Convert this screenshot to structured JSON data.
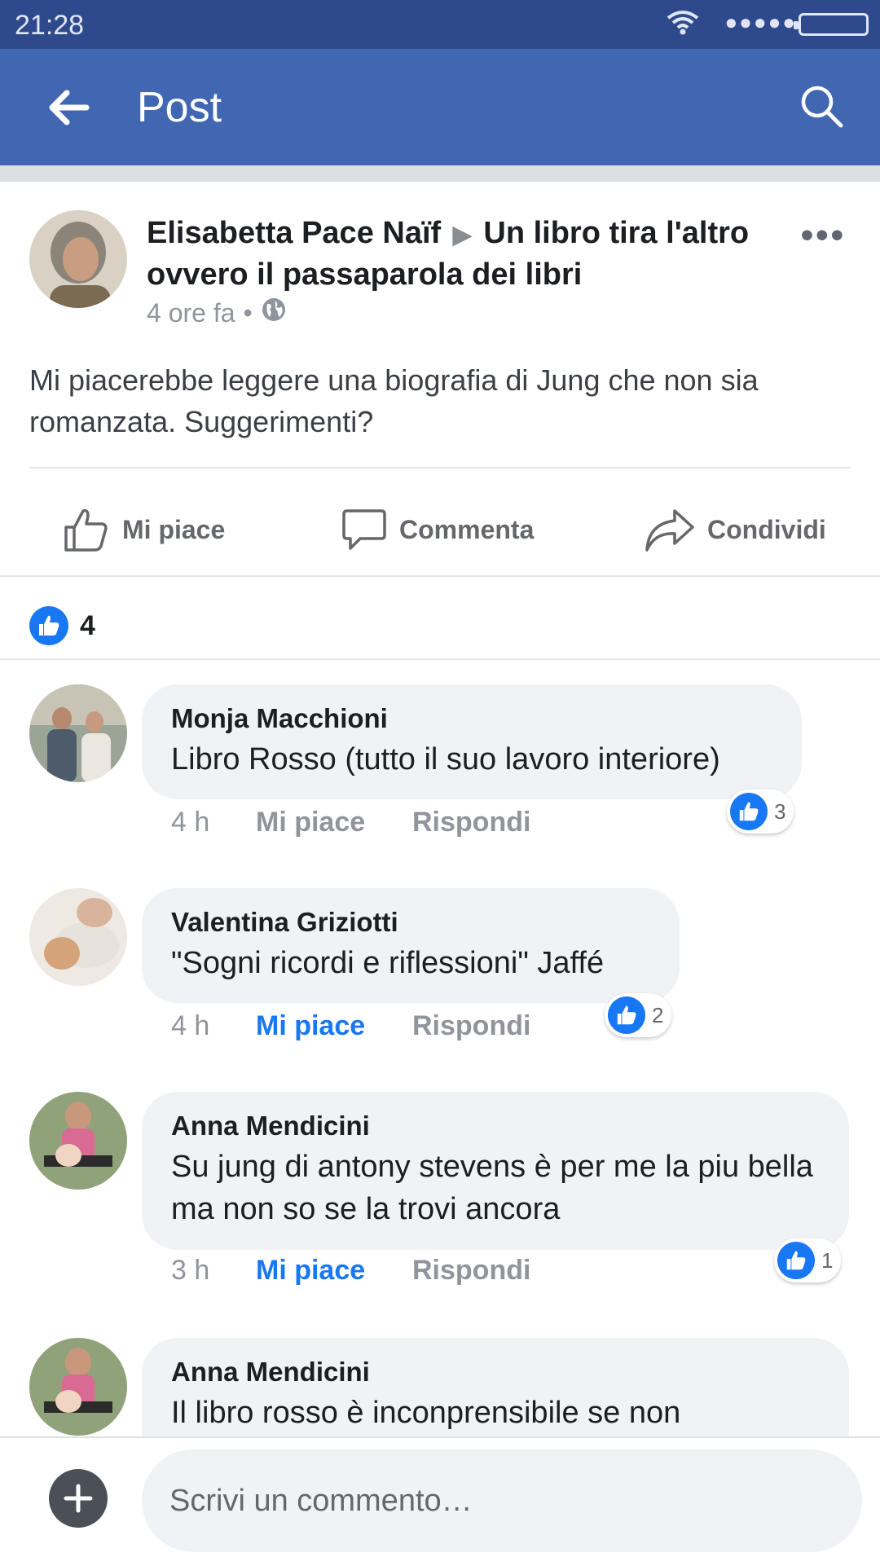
{
  "status_bar": {
    "time": "21:28",
    "signal": "●●●●●"
  },
  "app_bar": {
    "title": "Post",
    "back_icon": "arrow-left-icon",
    "search_icon": "search-icon"
  },
  "post": {
    "author": "Elisabetta Pace Naïf",
    "group": "Un libro tira l'altro ovvero il passaparola dei libri",
    "time": "4 ore fa",
    "separator": "•",
    "privacy_icon": "globe-icon",
    "more": "•••",
    "text": "Mi piacerebbe leggere una biografia di Jung che non sia romanzata. Suggerimenti?"
  },
  "actions": {
    "like": "Mi piace",
    "comment": "Commenta",
    "share": "Condividi"
  },
  "reactions": {
    "count": "4"
  },
  "comments": [
    {
      "name": "Monja Macchioni",
      "text": "Libro Rosso (tutto il suo lavoro interiore)",
      "time": "4 h",
      "like": "Mi piace",
      "liked": false,
      "reply": "Rispondi",
      "likes": "3"
    },
    {
      "name": "Valentina Griziotti",
      "text": "\"Sogni ricordi e riflessioni\" Jaffé",
      "time": "4 h",
      "like": "Mi piace",
      "liked": true,
      "reply": "Rispondi",
      "likes": "2"
    },
    {
      "name": "Anna Mendicini",
      "text": "Su jung di antony stevens è per me la piu bella ma non so se la trovi ancora",
      "time": "3 h",
      "like": "Mi piace",
      "liked": true,
      "reply": "Rispondi",
      "likes": "1"
    },
    {
      "name": "Anna Mendicini",
      "text": "Il libro rosso è inconprensibile se non"
    }
  ],
  "composer": {
    "placeholder": "Scrivi un commento…",
    "add_icon": "plus-icon"
  },
  "colors": {
    "app_bar": "#4267b2",
    "status_bar": "#2f4a8c",
    "link_blue": "#1877f2",
    "bubble": "#f0f2f5"
  }
}
